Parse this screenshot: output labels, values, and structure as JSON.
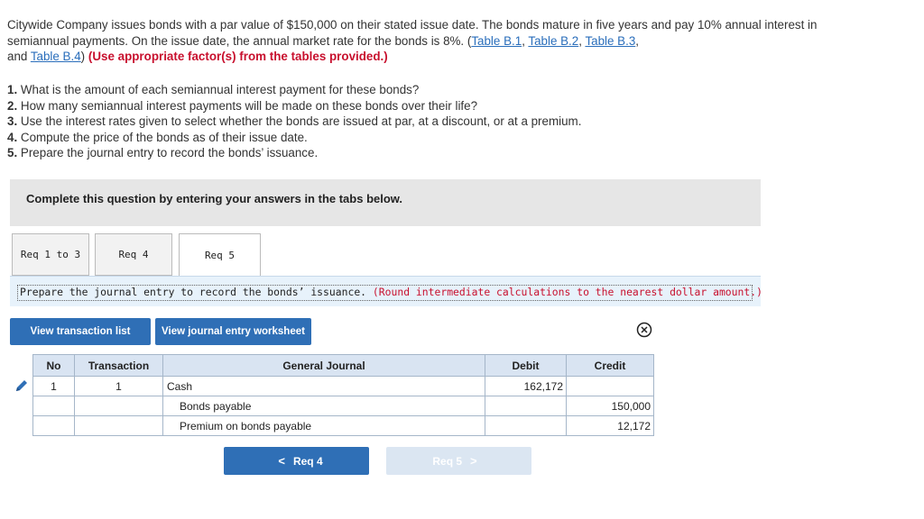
{
  "intro": {
    "text1": "Citywide Company issues bonds with a par value of $150,000 on their stated issue date. The bonds mature in five years and pay 10% annual interest in semiannual payments. On the issue date, the annual market rate for the bonds is 8%. (",
    "links": [
      "Table B.1",
      "Table B.2",
      "Table B.3",
      "Table B.4"
    ],
    "sep": ", ",
    "and_text": "and ",
    "close_paren": ")",
    "red_note": "(Use appropriate factor(s) from the tables provided.)"
  },
  "questions": [
    {
      "num": "1.",
      "text": "What is the amount of each semiannual interest payment for these bonds?"
    },
    {
      "num": "2.",
      "text": "How many semiannual interest payments will be made on these bonds over their life?"
    },
    {
      "num": "3.",
      "text": "Use the interest rates given to select whether the bonds are issued at par, at a discount, or at a premium."
    },
    {
      "num": "4.",
      "text": "Compute the price of the bonds as of their issue date."
    },
    {
      "num": "5.",
      "text": "Prepare the journal entry to record the bonds’ issuance."
    }
  ],
  "banner": "Complete this question by entering your answers in the tabs below.",
  "tabs": [
    "Req 1 to 3",
    "Req 4",
    "Req 5"
  ],
  "active_tab": "Req 5",
  "instruction": {
    "main": "Prepare the journal entry to record the bonds’ issuance.",
    "note": "(Round intermediate calculations to the nearest dollar amount.)"
  },
  "buttons": {
    "view_transactions": "View transaction list",
    "view_worksheet": "View journal entry worksheet"
  },
  "journal": {
    "headers": [
      "No",
      "Transaction",
      "General Journal",
      "Debit",
      "Credit"
    ],
    "rows": [
      {
        "no": "1",
        "transaction": "1",
        "account": "Cash",
        "debit": "162,172",
        "credit": ""
      },
      {
        "no": "",
        "transaction": "",
        "account": "Bonds payable",
        "debit": "",
        "credit": "150,000"
      },
      {
        "no": "",
        "transaction": "",
        "account": "Premium on bonds payable",
        "debit": "",
        "credit": "12,172"
      }
    ]
  },
  "nav": {
    "prev": "Req 4",
    "next": "Req 5"
  },
  "colors": {
    "accent": "#2f6fb6",
    "warning_red": "#c8102e",
    "link": "#2a6ebb"
  }
}
